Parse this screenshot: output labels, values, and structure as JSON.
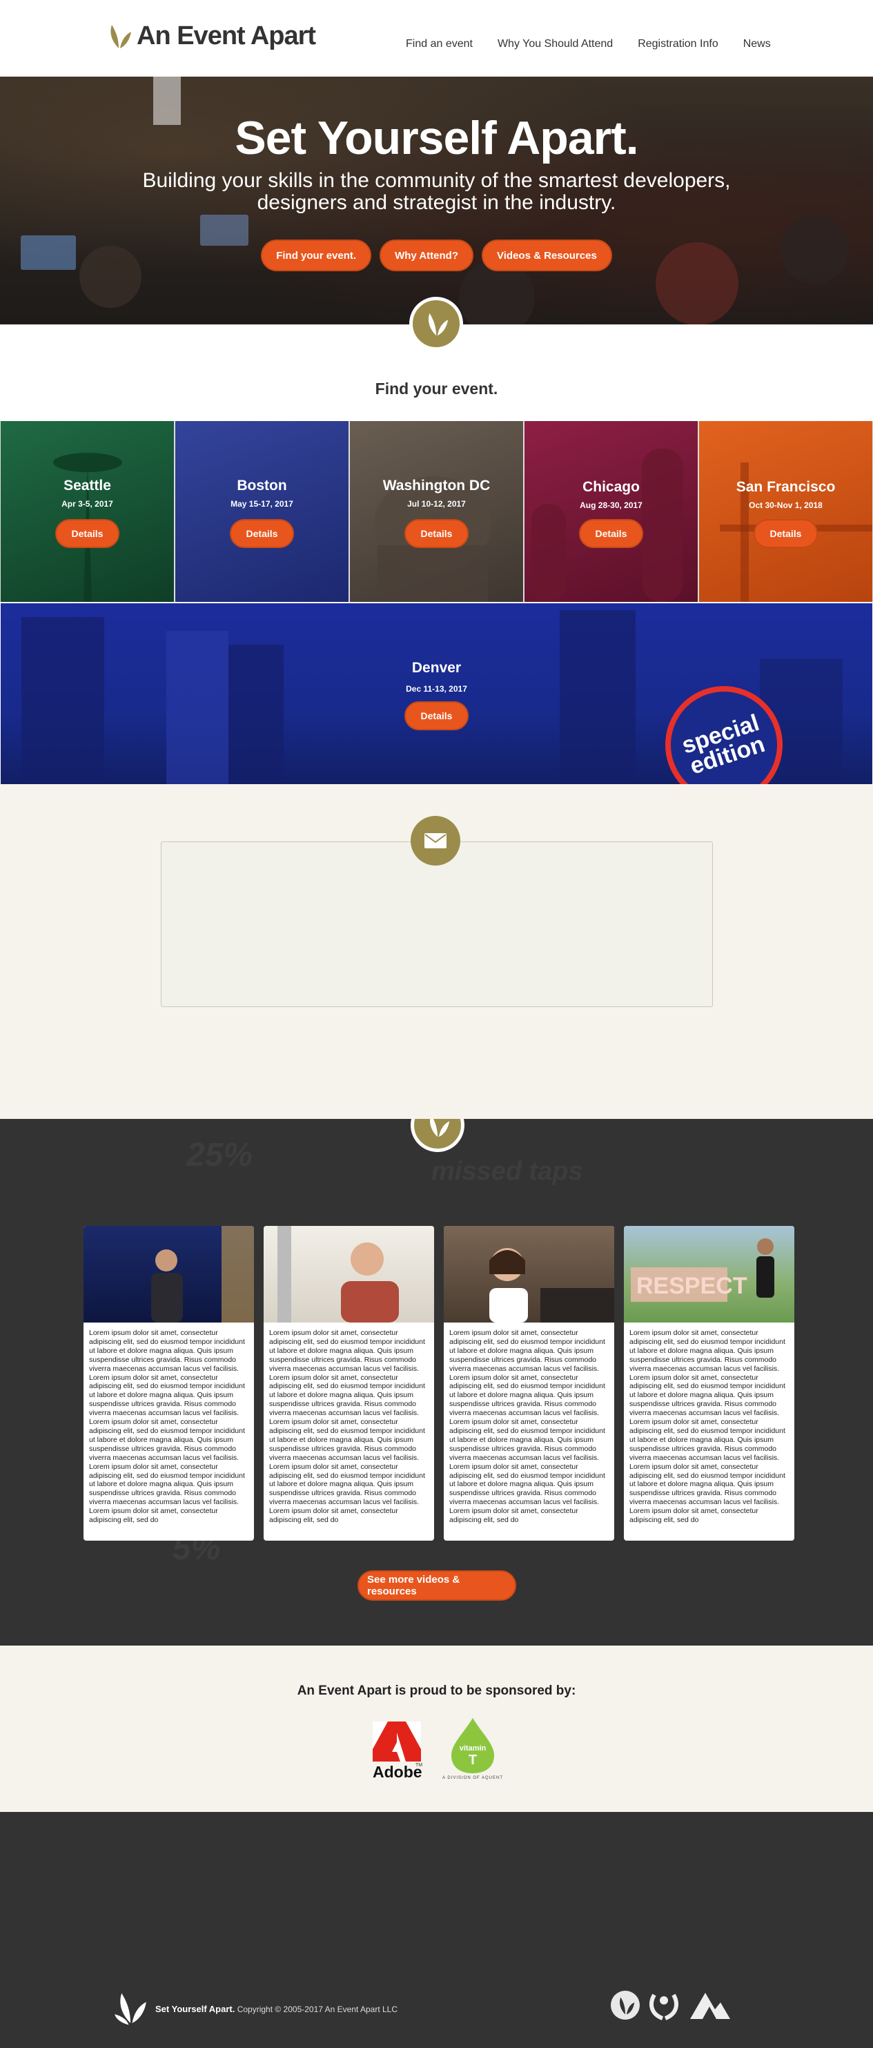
{
  "header": {
    "logo_text": "An Event Apart",
    "nav": [
      "Find an event",
      "Why You Should Attend",
      "Registration Info",
      "News"
    ]
  },
  "hero": {
    "title": "Set Yourself Apart.",
    "subtitle": "Building your skills in the community of the smartest developers, designers and strategist in the industry.",
    "buttons": [
      "Find your event.",
      "Why Attend?",
      "Videos & Resources"
    ]
  },
  "find": {
    "heading": "Find your event."
  },
  "cities": [
    {
      "name": "Seattle",
      "date": "Apr 3-5, 2017",
      "button": "Details",
      "color": "#1d5a3a"
    },
    {
      "name": "Boston",
      "date": "May 15-17, 2017",
      "button": "Details",
      "color": "#2a3a8a"
    },
    {
      "name": "Washington DC",
      "date": "Jul 10-12, 2017",
      "button": "Details",
      "color": "#5a5046"
    },
    {
      "name": "Chicago",
      "date": "Aug 28-30, 2017",
      "button": "Details",
      "color": "#7a1a3a"
    },
    {
      "name": "San Francisco",
      "date": "Oct 30-Nov 1, 2018",
      "button": "Details",
      "color": "#d2541a"
    }
  ],
  "denver": {
    "name": "Denver",
    "date": "Dec 11-13, 2017",
    "button": "Details",
    "badge_line1": "special",
    "badge_line2": "edition"
  },
  "videos": {
    "card_text": "Lorem ipsum dolor sit amet, consectetur adipiscing elit, sed do eiusmod tempor incididunt ut labore et dolore magna aliqua. Quis ipsum suspendisse ultrices gravida. Risus commodo viverra maecenas accumsan lacus vel facilisis. Lorem ipsum dolor sit amet, consectetur adipiscing elit, sed do eiusmod tempor incididunt ut labore et dolore magna aliqua. Quis ipsum suspendisse ultrices gravida. Risus commodo viverra maecenas accumsan lacus vel facilisis. Lorem ipsum dolor sit amet, consectetur adipiscing elit, sed do eiusmod tempor incididunt ut labore et dolore magna aliqua. Quis ipsum suspendisse ultrices gravida. Risus commodo viverra maecenas accumsan lacus vel facilisis. Lorem ipsum dolor sit amet, consectetur adipiscing elit, sed do eiusmod tempor incididunt ut labore et dolore magna aliqua. Quis ipsum suspendisse ultrices gravida. Risus commodo viverra maecenas accumsan lacus vel facilisis. Lorem ipsum dolor sit amet, consectetur adipiscing elit, sed do",
    "card_text_2": "Lorem ipsum dolor sit amet, consectetur adipiscing elit, sed do eiusmod tempor incididunt ut labore et dolore magna aliqua. Quis ipsum suspendisse ultrices gravida. Risus commodo viverra maecenas accumsan lacus vel facilisis. Lorem ipsum dolor sit amet, consectetur adipiscing elit, sed do eiusmod tempor incididunt ut labore et dolore magna aliqua. Quis ipsum suspendisse ultrices gravida. Risus commodo viverra maecenas accumsan lacus vel facilisis. Lorem ipsum dolor sit amet, consectetur adipiscing elit, sed do eiusmod tempor incididunt ut labore et dolore magna aliqua. Quis ipsum suspendisse ultrices gravida. Risus commodo viverra maecenas accumsan lacus vel facilisis. Lorem ipsum dolor sit amet, consectetur adipiscing elit, sed do eiusmod tempor incididunt ut labore et dolore magna aliqua. Quis ipsum suspendisse ultrices gravida. Risus commodo viverra maecenas accumsan lacus vel facilisis. Lorem ipsum dolor sit amet, consectetur adipiscing elit, sed do",
    "card_text_3": "Lorem ipsum dolor sit amet, consectetur adipiscing elit, sed do eiusmod tempor incididunt ut labore et dolore magna aliqua. Quis ipsum suspendisse ultrices gravida. Risus commodo viverra maecenas accumsan lacus vel facilisis. Lorem ipsum dolor sit amet, consectetur adipiscing elit, sed do eiusmod tempor incididunt ut labore et dolore magna aliqua. Quis ipsum suspendisse ultrices gravida. Risus commodo viverra maecenas accumsan lacus vel facilisis. Lorem ipsum dolor sit amet, consectetur adipiscing elit, sed do eiusmod tempor incididunt ut labore et dolore magna aliqua. Quis ipsum suspendisse ultrices gravida. Risus commodo viverra maecenas accumsan lacus vel facilisis. Lorem ipsum dolor sit amet, consectetur adipiscing elit, sed do eiusmod tempor incididunt ut labore et dolore magna aliqua. Quis ipsum suspendisse ultrices gravida. Risus commodo viverra maecenas accumsan lacus vel facilisis. Lorem ipsum dolor sit amet, consectetur adipiscing elit, sed do",
    "card_text_4": "Lorem ipsum dolor sit amet, consectetur adipiscing elit, sed do eiusmod tempor incididunt ut labore et dolore magna aliqua. Quis ipsum suspendisse ultrices gravida. Risus commodo viverra maecenas accumsan lacus vel facilisis. Lorem ipsum dolor sit amet, consectetur adipiscing elit, sed do eiusmod tempor incididunt ut labore et dolore magna aliqua. Quis ipsum suspendisse ultrices gravida. Risus commodo viverra maecenas accumsan lacus vel facilisis. Lorem ipsum dolor sit amet, consectetur adipiscing elit, sed do eiusmod tempor incididunt ut labore et dolore magna aliqua. Quis ipsum suspendisse ultrices gravida. Risus commodo viverra maecenas accumsan lacus vel facilisis. Lorem ipsum dolor sit amet, consectetur adipiscing elit, sed do eiusmod tempor incididunt ut labore et dolore magna aliqua. Quis ipsum suspendisse ultrices gravida. Risus commodo viverra maecenas accumsan lacus vel facilisis. Lorem ipsum dolor sit amet, consectetur adipiscing elit, sed do",
    "bg_text_1": "25%",
    "bg_text_2": "missed taps",
    "bg_text_3": "5%",
    "photo_sign": "RESPECT",
    "more_button": "See more videos & resources"
  },
  "sponsors": {
    "heading": "An Event Apart is proud to be sponsored by:",
    "adobe": "Adobe",
    "adobe_tm": "TM",
    "vitamin_line1": "vitamin",
    "vitamin_line2": "T",
    "vitamin_sub": "A DIVISION OF AQUENT"
  },
  "footer": {
    "tagline": "Set Yourself Apart.",
    "copyright": "Copyright © 2005-2017 An Event Apart LLC"
  },
  "colors": {
    "accent": "#e8561e",
    "olive": "#9b8c4c",
    "dark": "#333333",
    "cream": "#f5f3ec"
  }
}
